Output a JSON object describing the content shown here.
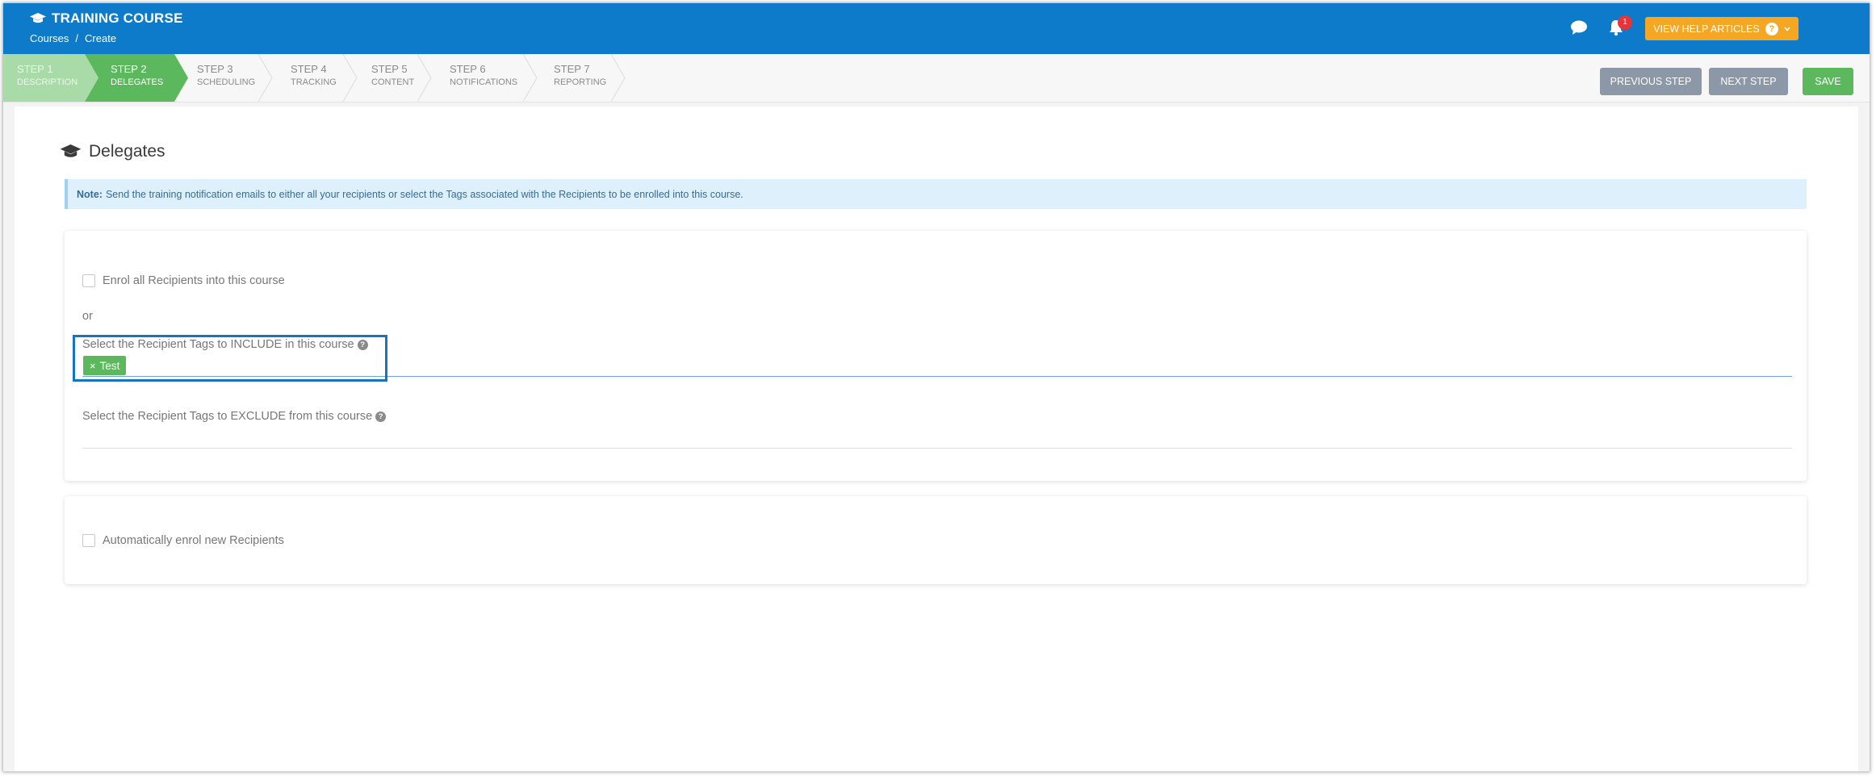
{
  "header": {
    "title": "TRAINING COURSE",
    "breadcrumb": [
      "Courses",
      "/",
      "Create"
    ],
    "notification_count": "1",
    "help_button": "VIEW HELP ARTICLES"
  },
  "steps": [
    {
      "num": "STEP 1",
      "label": "DESCRIPTION",
      "state": "done"
    },
    {
      "num": "STEP 2",
      "label": "DELEGATES",
      "state": "active"
    },
    {
      "num": "STEP 3",
      "label": "SCHEDULING",
      "state": "todo"
    },
    {
      "num": "STEP 4",
      "label": "TRACKING",
      "state": "todo"
    },
    {
      "num": "STEP 5",
      "label": "CONTENT",
      "state": "todo"
    },
    {
      "num": "STEP 6",
      "label": "NOTIFICATIONS",
      "state": "todo"
    },
    {
      "num": "STEP 7",
      "label": "REPORTING",
      "state": "todo"
    }
  ],
  "actions": {
    "previous": "PREVIOUS STEP",
    "next": "NEXT STEP",
    "save": "SAVE"
  },
  "section": {
    "title": "Delegates",
    "note_label": "Note:",
    "note_text": "Send the training notification emails to either all your recipients or select the Tags associated with the Recipients to be enrolled into this course."
  },
  "form": {
    "enrol_all": "Enrol all Recipients into this course",
    "or": "or",
    "include_label": "Select the Recipient Tags to INCLUDE in this course",
    "include_tags": [
      "Test"
    ],
    "tag_remove": "×",
    "exclude_label": "Select the Recipient Tags to EXCLUDE from this course",
    "auto_enrol": "Automatically enrol new Recipients"
  },
  "colors": {
    "header_bg": "#0d7bc9",
    "step_done": "#a9dba9",
    "step_active": "#5cb85c",
    "help_button": "#f5a623",
    "save_button": "#5cb85c",
    "neutral_button": "#8c97a8",
    "highlight": "#1674c0"
  }
}
